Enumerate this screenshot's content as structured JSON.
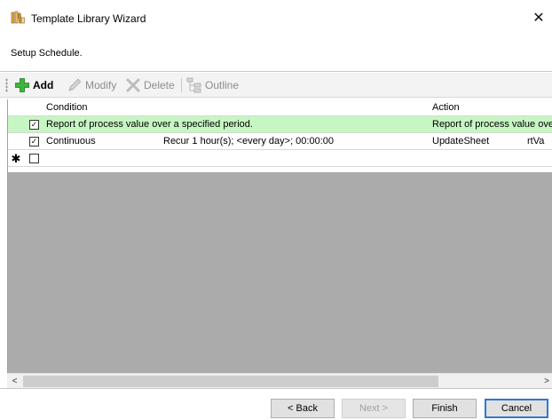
{
  "window": {
    "title": "Template Library Wizard",
    "close_glyph": "✕"
  },
  "subtitle": "Setup Schedule.",
  "toolbar": {
    "add": "Add",
    "modify": "Modify",
    "delete": "Delete",
    "outline": "Outline"
  },
  "grid": {
    "columns": [
      "Condition",
      "",
      "Action",
      ""
    ],
    "rows": [
      {
        "checked": true,
        "condition": "Report of process value over a specified period.",
        "schedule": "",
        "action": "Report of process value over",
        "extra": ""
      },
      {
        "checked": true,
        "condition": "Continuous",
        "schedule": "Recur 1 hour(s); <every day>; 00:00:00",
        "action": "UpdateSheet",
        "extra": "rtVa"
      },
      {
        "checked": false,
        "condition": "",
        "schedule": "",
        "action": "",
        "extra": "",
        "new_row_marker": "✱"
      }
    ],
    "row_highlight_color": "#c6f6c2",
    "check_glyph": "✓"
  },
  "scrollbar": {
    "left_arrow": "<",
    "right_arrow": ">"
  },
  "buttons": {
    "back": "< Back",
    "next": "Next >",
    "finish": "Finish",
    "cancel": "Cancel"
  }
}
